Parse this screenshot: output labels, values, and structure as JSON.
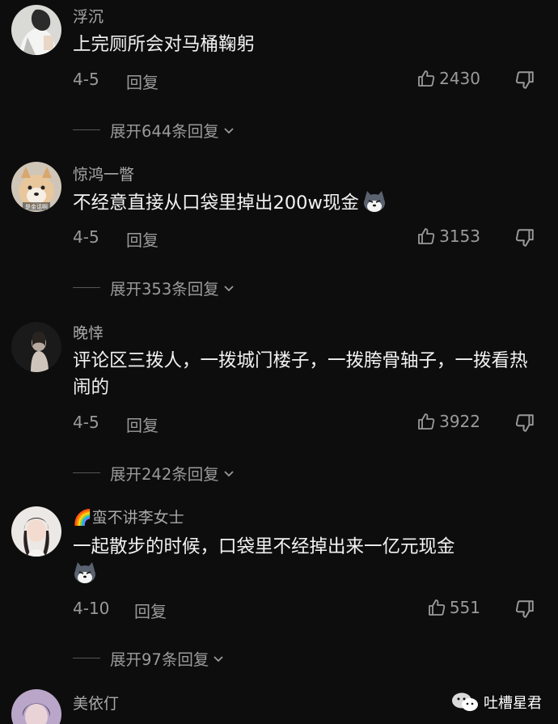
{
  "comments": [
    {
      "username": "浮沉",
      "content": "上完厕所会对马桶鞠躬",
      "date": "4-5",
      "reply_label": "回复",
      "likes": "2430",
      "expand_label": "展开644条回复"
    },
    {
      "username": "惊鸿一瞥",
      "content": "不经意直接从口袋里掉出200w现金",
      "avatar_text": "是金话啊",
      "date": "4-5",
      "reply_label": "回复",
      "likes": "3153",
      "expand_label": "展开353条回复"
    },
    {
      "username": "晚悻",
      "content": "评论区三拨人，一拨城门楼子，一拨胯骨轴子，一拨看热闹的",
      "date": "4-5",
      "reply_label": "回复",
      "likes": "3922",
      "expand_label": "展开242条回复"
    },
    {
      "username": "🌈蛮不讲李女士",
      "content": "一起散步的时候，口袋里不经掉出来一亿元现金",
      "date": "4-10",
      "reply_label": "回复",
      "likes": "551",
      "expand_label": "展开97条回复"
    },
    {
      "username": "美依仃"
    }
  ],
  "watermark": "吐槽星君",
  "colors": {
    "background": "#0d0d0d",
    "username": "#a9a9a9",
    "content": "#f2f2f2",
    "meta": "#9a9a9a"
  }
}
